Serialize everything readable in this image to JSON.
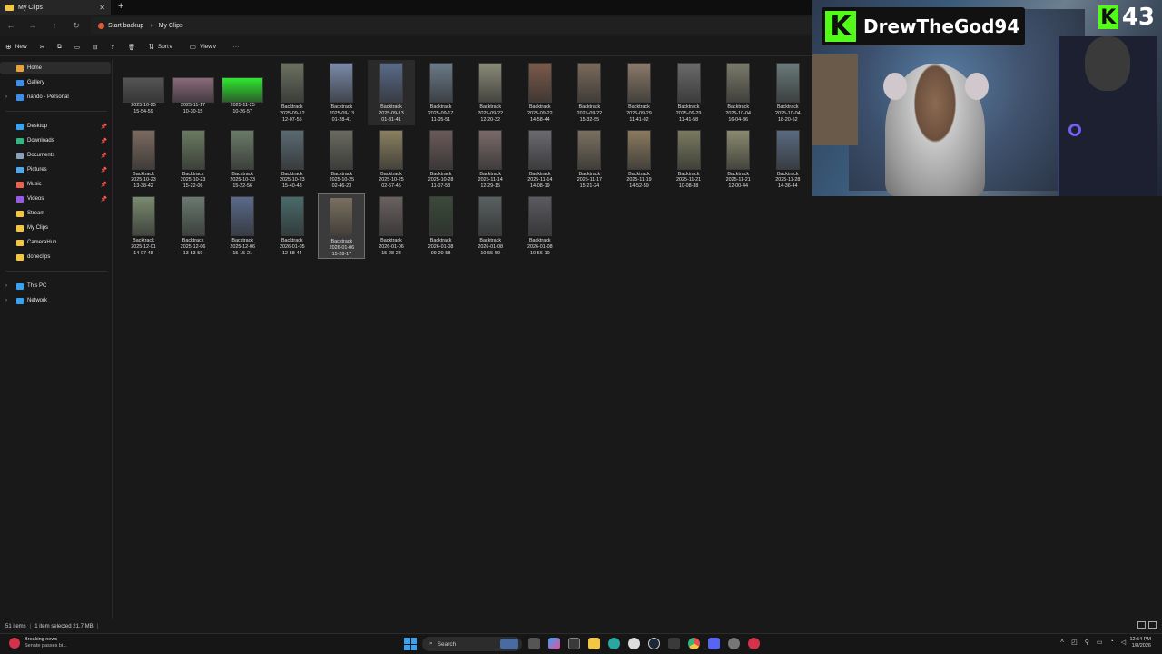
{
  "window": {
    "tab_title": "My Clips",
    "tab_close": "✕",
    "new_tab": "+"
  },
  "address": {
    "crumbs": [
      "Start backup",
      "My Clips"
    ],
    "separator": "›"
  },
  "toolbar": {
    "new_label": "New",
    "sort_label": "Sort",
    "view_label": "View",
    "more_label": "···"
  },
  "sidebar": {
    "top": [
      {
        "label": "Home",
        "icon": "home-icon",
        "color": "#e9a23b",
        "active": true
      },
      {
        "label": "Gallery",
        "icon": "gallery-icon",
        "color": "#3b8ee9"
      },
      {
        "label": "nando - Personal",
        "icon": "cloud-icon",
        "color": "#3b8ee9",
        "expand": true
      }
    ],
    "pinned": [
      {
        "label": "Desktop",
        "icon": "desktop-icon",
        "color": "#3aa3f0"
      },
      {
        "label": "Downloads",
        "icon": "downloads-icon",
        "color": "#36b37e"
      },
      {
        "label": "Documents",
        "icon": "documents-icon",
        "color": "#8aa0b8"
      },
      {
        "label": "Pictures",
        "icon": "pictures-icon",
        "color": "#4fa8e8"
      },
      {
        "label": "Music",
        "icon": "music-icon",
        "color": "#e8644f"
      },
      {
        "label": "Videos",
        "icon": "videos-icon",
        "color": "#9b59e8"
      },
      {
        "label": "Stream",
        "icon": "folder-icon",
        "color": "#f2c744"
      },
      {
        "label": "My Clips",
        "icon": "folder-icon",
        "color": "#f2c744"
      },
      {
        "label": "CameraHub",
        "icon": "folder-icon",
        "color": "#f2c744"
      },
      {
        "label": "doneclips",
        "icon": "folder-icon",
        "color": "#f2c744"
      }
    ],
    "bottom": [
      {
        "label": "This PC",
        "icon": "pc-icon",
        "color": "#3aa3f0"
      },
      {
        "label": "Network",
        "icon": "network-icon",
        "color": "#3aa3f0"
      }
    ]
  },
  "files": [
    {
      "name": "",
      "date": "2025-10-25",
      "time": "15-54-59",
      "wide": true,
      "color": "#555555"
    },
    {
      "name": "",
      "date": "2025-11-17",
      "time": "10-30-15",
      "wide": true,
      "color": "#8a6a7a"
    },
    {
      "name": "",
      "date": "2025-11-25",
      "time": "10-26-57",
      "wide": true,
      "color": "#2ee82e"
    },
    {
      "name": "Backtrack",
      "date": "2025-09-12",
      "time": "12-07-55",
      "color": "#6a7060"
    },
    {
      "name": "Backtrack",
      "date": "2025-09-13",
      "time": "01-28-41",
      "color": "#7a8aa8"
    },
    {
      "name": "Backtrack",
      "date": "2025-09-13",
      "time": "01-31-41",
      "color": "#5a6a88",
      "hover": true
    },
    {
      "name": "Backtrack",
      "date": "2025-09-17",
      "time": "11-05-51",
      "color": "#6a7a88"
    },
    {
      "name": "Backtrack",
      "date": "2025-09-22",
      "time": "12-20-32",
      "color": "#8a8a78"
    },
    {
      "name": "Backtrack",
      "date": "2025-09-22",
      "time": "14-58-44",
      "color": "#7a5a4a"
    },
    {
      "name": "Backtrack",
      "date": "2025-09-22",
      "time": "15-32-55",
      "color": "#7a6a5a"
    },
    {
      "name": "Backtrack",
      "date": "2025-09-29",
      "time": "11-41-02",
      "color": "#8a7a6a"
    },
    {
      "name": "Backtrack",
      "date": "2025-09-29",
      "time": "11-41-58",
      "color": "#6a6a6a"
    },
    {
      "name": "Backtrack",
      "date": "2025-10-04",
      "time": "16-04-36",
      "color": "#7a7a6a"
    },
    {
      "name": "Backtrack",
      "date": "2025-10-04",
      "time": "18-20-52",
      "color": "#6a7a7a"
    },
    {
      "name": "Backtrack",
      "date": "2025-10-23",
      "time": "13-38-42",
      "color": "#7a6a60"
    },
    {
      "name": "Backtrack",
      "date": "2025-10-23",
      "time": "15-22-06",
      "color": "#6a7a60"
    },
    {
      "name": "Backtrack",
      "date": "2025-10-23",
      "time": "15-22-56",
      "color": "#6a7a68"
    },
    {
      "name": "Backtrack",
      "date": "2025-10-23",
      "time": "15-40-48",
      "color": "#5a6a70"
    },
    {
      "name": "Backtrack",
      "date": "2025-10-25",
      "time": "02-46-23",
      "color": "#6a6a60"
    },
    {
      "name": "Backtrack",
      "date": "2025-10-25",
      "time": "02-57-45",
      "color": "#8a8060"
    },
    {
      "name": "Backtrack",
      "date": "2025-10-28",
      "time": "11-07-58",
      "color": "#6a5a5a"
    },
    {
      "name": "Backtrack",
      "date": "2025-11-14",
      "time": "12-29-15",
      "color": "#7a6a6a"
    },
    {
      "name": "Backtrack",
      "date": "2025-11-14",
      "time": "14-08-19",
      "color": "#6a6a70"
    },
    {
      "name": "Backtrack",
      "date": "2025-11-17",
      "time": "15-21-24",
      "color": "#7a7060"
    },
    {
      "name": "Backtrack",
      "date": "2025-11-19",
      "time": "14-52-59",
      "color": "#8a7a60"
    },
    {
      "name": "Backtrack",
      "date": "2025-11-21",
      "time": "10-08-38",
      "color": "#7a7a60"
    },
    {
      "name": "Backtrack",
      "date": "2025-11-21",
      "time": "12-00-44",
      "color": "#8a8a70"
    },
    {
      "name": "Backtrack",
      "date": "2025-11-28",
      "time": "14-36-44",
      "color": "#5a6a80"
    },
    {
      "name": "Backtrack",
      "date": "2025-12-01",
      "time": "14-07-48",
      "color": "#7a8a70"
    },
    {
      "name": "Backtrack",
      "date": "2025-12-06",
      "time": "13-53-59",
      "color": "#6a7a70"
    },
    {
      "name": "Backtrack",
      "date": "2025-12-06",
      "time": "15-15-21",
      "color": "#5a6a8a"
    },
    {
      "name": "Backtrack",
      "date": "2026-01-05",
      "time": "12-58-44",
      "color": "#4a6a6a"
    },
    {
      "name": "Backtrack",
      "date": "2026-01-06",
      "time": "15-28-17",
      "color": "#7a7060",
      "selected": true
    },
    {
      "name": "Backtrack",
      "date": "2026-01-06",
      "time": "15-28-23",
      "color": "#6a6060"
    },
    {
      "name": "Backtrack",
      "date": "2026-01-08",
      "time": "09-20-58",
      "color": "#3a4a3a"
    },
    {
      "name": "Backtrack",
      "date": "2026-01-08",
      "time": "10-55-59",
      "color": "#5a6060"
    },
    {
      "name": "Backtrack",
      "date": "2026-01-08",
      "time": "10-56-10",
      "color": "#5a5a60"
    }
  ],
  "status": {
    "count": "51 items",
    "selection": "1 item selected  21.7 MB"
  },
  "taskbar": {
    "news_title": "Breaking news",
    "news_sub": "Senate passes bi...",
    "search_label": "Search",
    "time": "12:54 PM",
    "date": "1/8/2026"
  },
  "overlay": {
    "kick_glyph": "K",
    "streamer_name": "DrewTheGod94",
    "viewer_count": "43"
  },
  "colors": {
    "kick_green": "#53fc18",
    "folder_yellow": "#f2c744",
    "accent_blue": "#3aa3f0"
  }
}
